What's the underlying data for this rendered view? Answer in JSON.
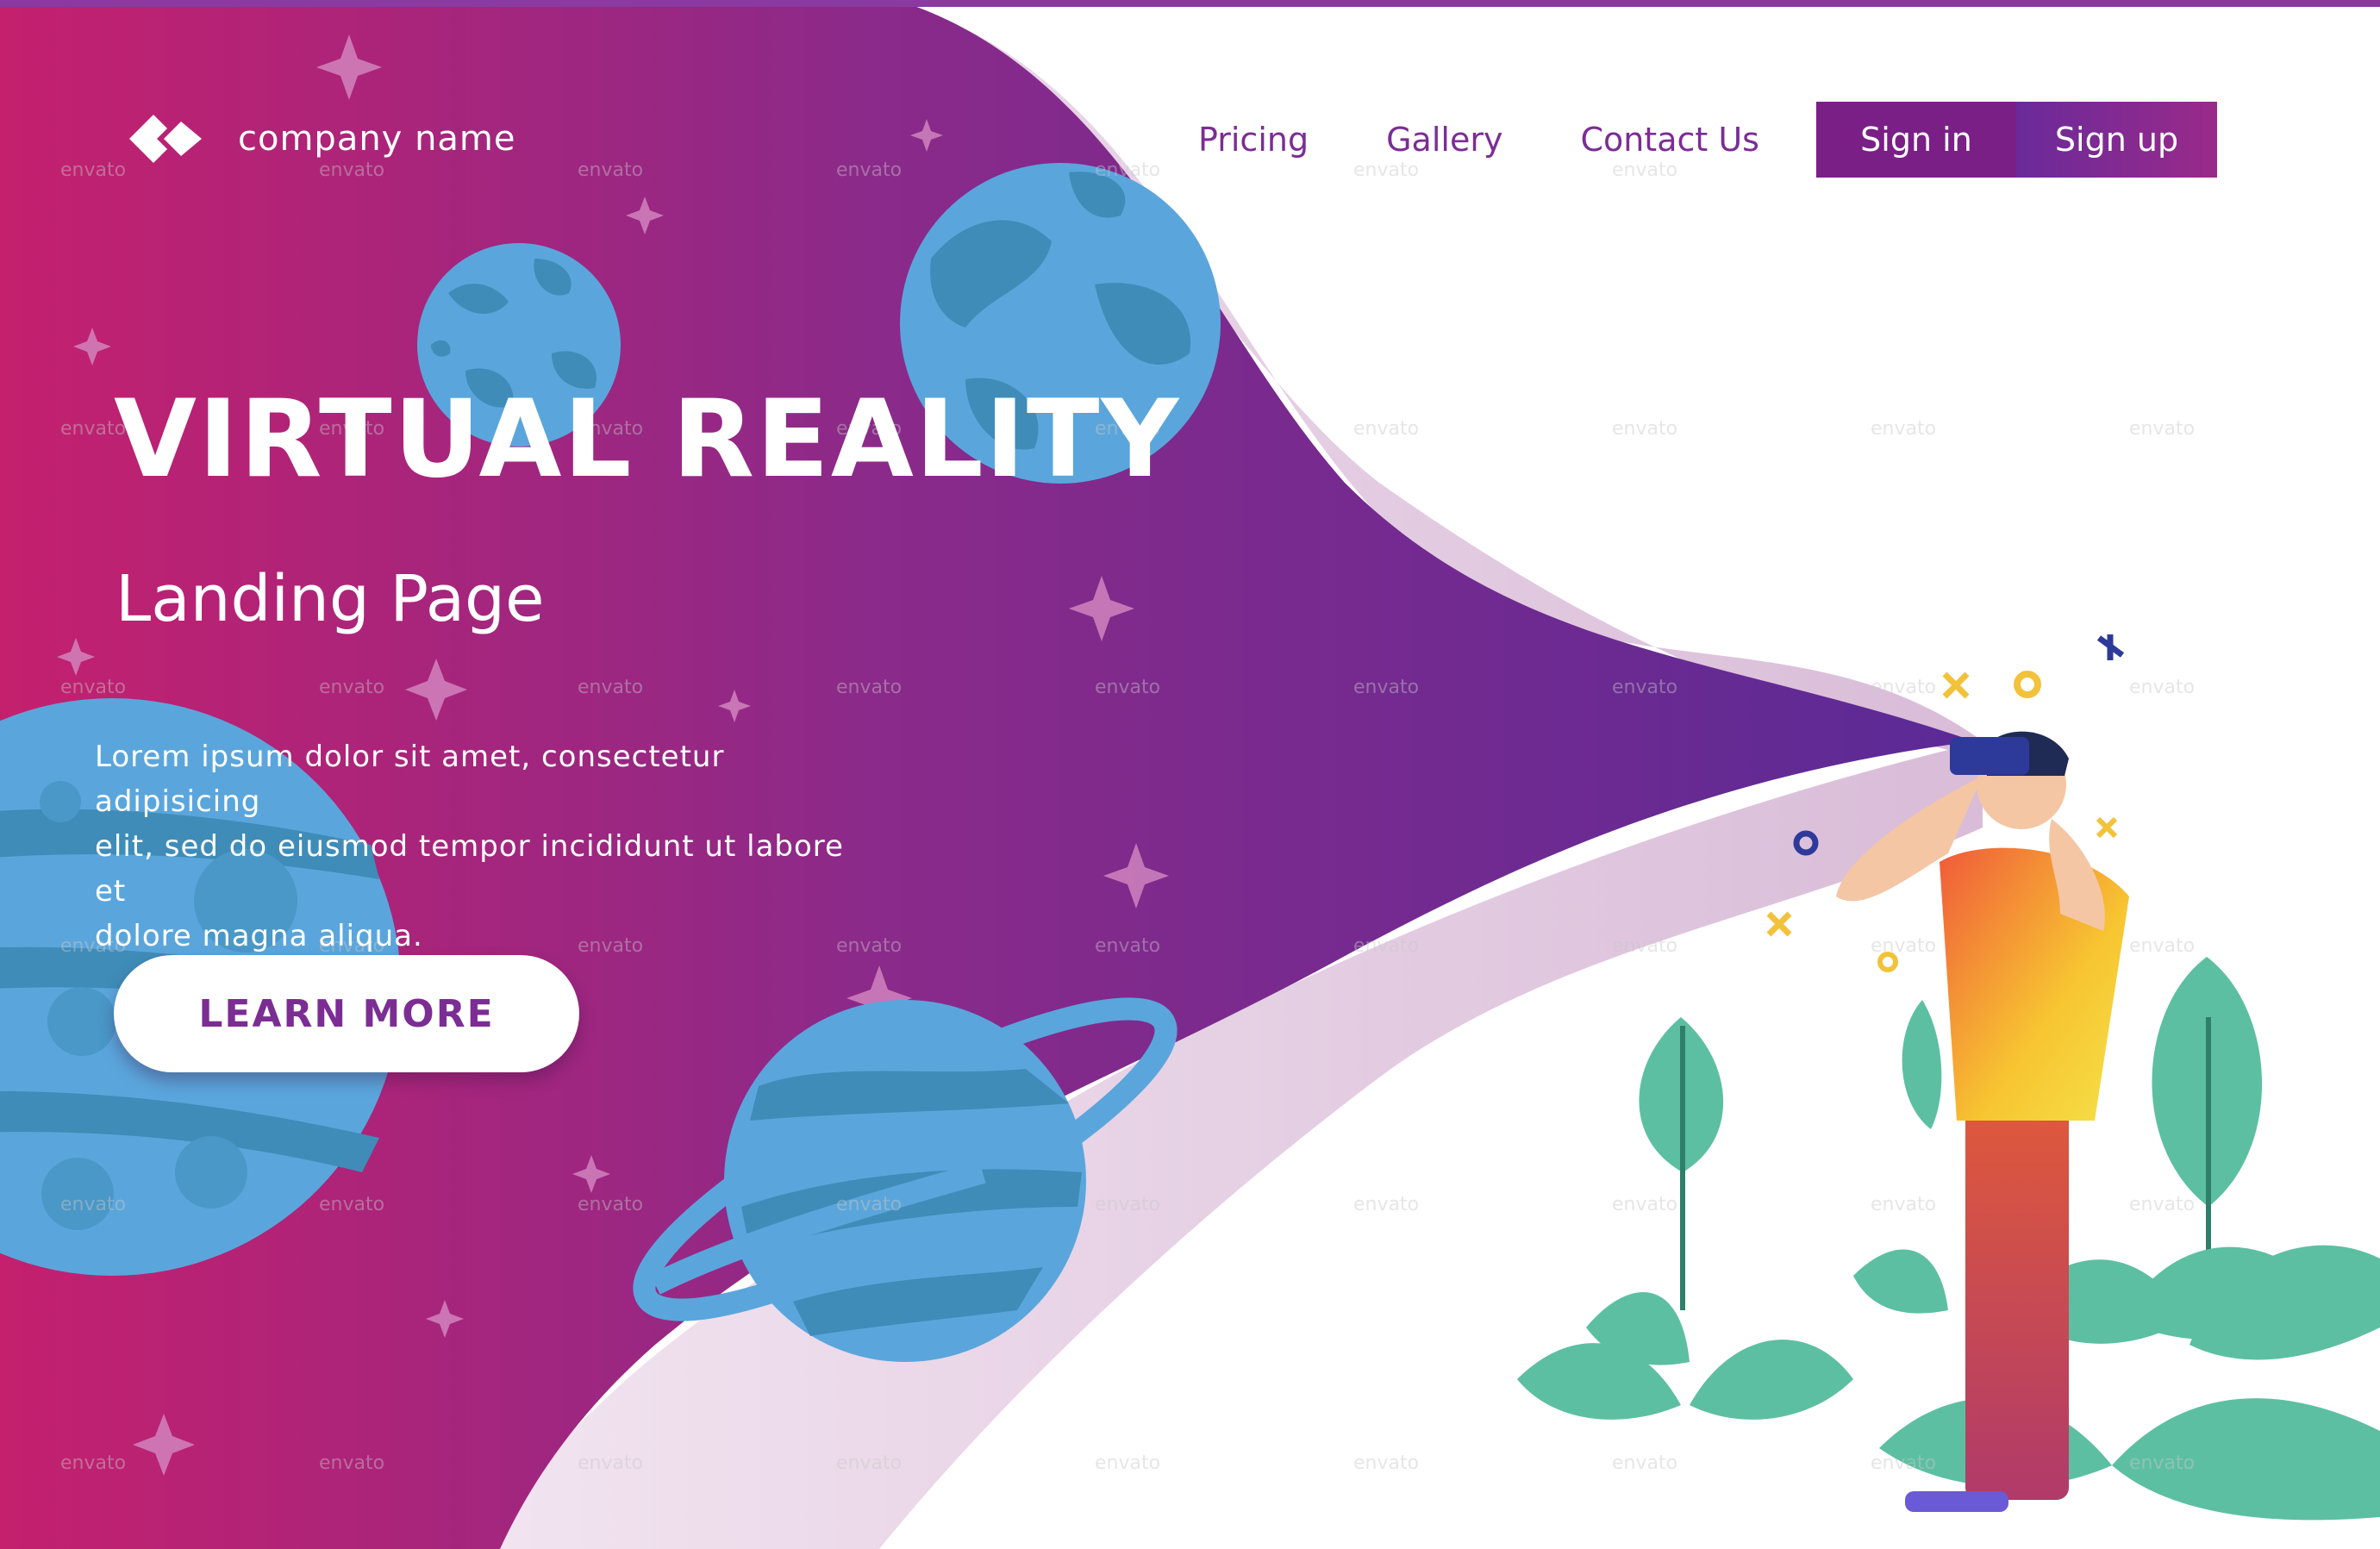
{
  "brand": {
    "logo_icon": "diamond-chevron-logo",
    "company_name": "company name"
  },
  "nav": {
    "links": [
      "Pricing",
      "Gallery",
      "Contact Us"
    ],
    "sign_in": "Sign in",
    "sign_up": "Sign up"
  },
  "hero": {
    "title": "VIRTUAL REALITY",
    "subtitle": "Landing Page",
    "body_lines": [
      "Lorem ipsum dolor sit amet, consectetur adipisicing",
      "elit, sed do eiusmod tempor incididunt ut labore et",
      "dolore magna aliqua."
    ],
    "cta_label": "LEARN MORE"
  },
  "watermark": "envato",
  "colors": {
    "gradient_start": "#c4206e",
    "gradient_end": "#5b2a96",
    "nav_text": "#7b2d94",
    "planet_blue": "#5aa6dc",
    "planet_dark": "#3f8cb8",
    "leaf_green": "#5dbfa2",
    "shirt_yellow": "#f7c531",
    "pants_red": "#e05a3a",
    "wave_pink": "#ecd6e8"
  }
}
